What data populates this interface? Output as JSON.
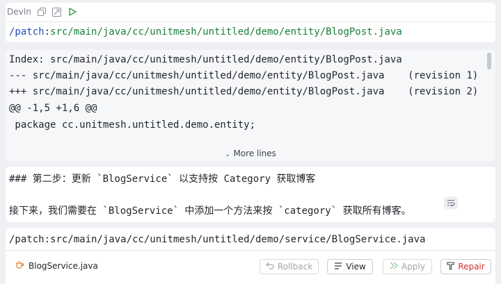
{
  "header": {
    "title": "DevIn",
    "icons": [
      "copy-icon",
      "insert-icon",
      "run-icon"
    ]
  },
  "top_command": {
    "keyword": "/patch",
    "separator": ":",
    "path": "src/main/java/cc/unitmesh/untitled/demo/entity/BlogPost.java"
  },
  "diff": {
    "lines": [
      "Index: src/main/java/cc/unitmesh/untitled/demo/entity/BlogPost.java",
      "--- src/main/java/cc/unitmesh/untitled/demo/entity/BlogPost.java    (revision 1)",
      "+++ src/main/java/cc/unitmesh/untitled/demo/entity/BlogPost.java    (revision 2)",
      "@@ -1,5 +1,6 @@",
      " package cc.unitmesh.untitled.demo.entity;"
    ],
    "more_lines_label": "More lines"
  },
  "message": {
    "heading": "### 第二步：更新 `BlogService` 以支持按 Category 获取博客",
    "body": "接下来，我们需要在 `BlogService` 中添加一个方法来按 `category` 获取所有博客。"
  },
  "second_command": {
    "text": "/patch:src/main/java/cc/unitmesh/untitled/demo/service/BlogService.java"
  },
  "footer": {
    "file_name": "BlogService.java",
    "buttons": {
      "rollback": "Rollback",
      "view": "View",
      "apply": "Apply",
      "repair": "Repair"
    }
  },
  "colors": {
    "keyword": "#1d4fbf",
    "path": "#1a7f37",
    "repair": "#d0312d",
    "run": "#2f9e44"
  }
}
